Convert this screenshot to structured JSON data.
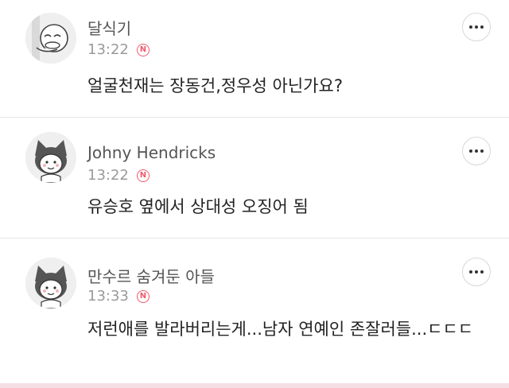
{
  "comments": [
    {
      "author": "달식기",
      "time": "13:22",
      "badge": "N",
      "text": "얼굴천재는 장동건,정우성 아닌가요?",
      "avatar_icon": "peeking-character-avatar-icon",
      "more_icon": "more-options-icon"
    },
    {
      "author": "Johny Hendricks",
      "time": "13:22",
      "badge": "N",
      "text": "유승호 옆에서 상대성 오징어 됨",
      "avatar_icon": "cat-hood-character-avatar-icon",
      "more_icon": "more-options-icon"
    },
    {
      "author": "만수르 숨겨둔 아들",
      "time": "13:33",
      "badge": "N",
      "text": "저런애를 발라버리는게...남자 연예인 존잘러들...ㄷㄷㄷ",
      "avatar_icon": "cat-hood-character-avatar-icon",
      "more_icon": "more-options-icon"
    }
  ],
  "colors": {
    "badge": "#f05a6b",
    "author": "#555555",
    "time": "#9a9a9a",
    "text": "#222222",
    "divider": "#e6e6e6"
  }
}
